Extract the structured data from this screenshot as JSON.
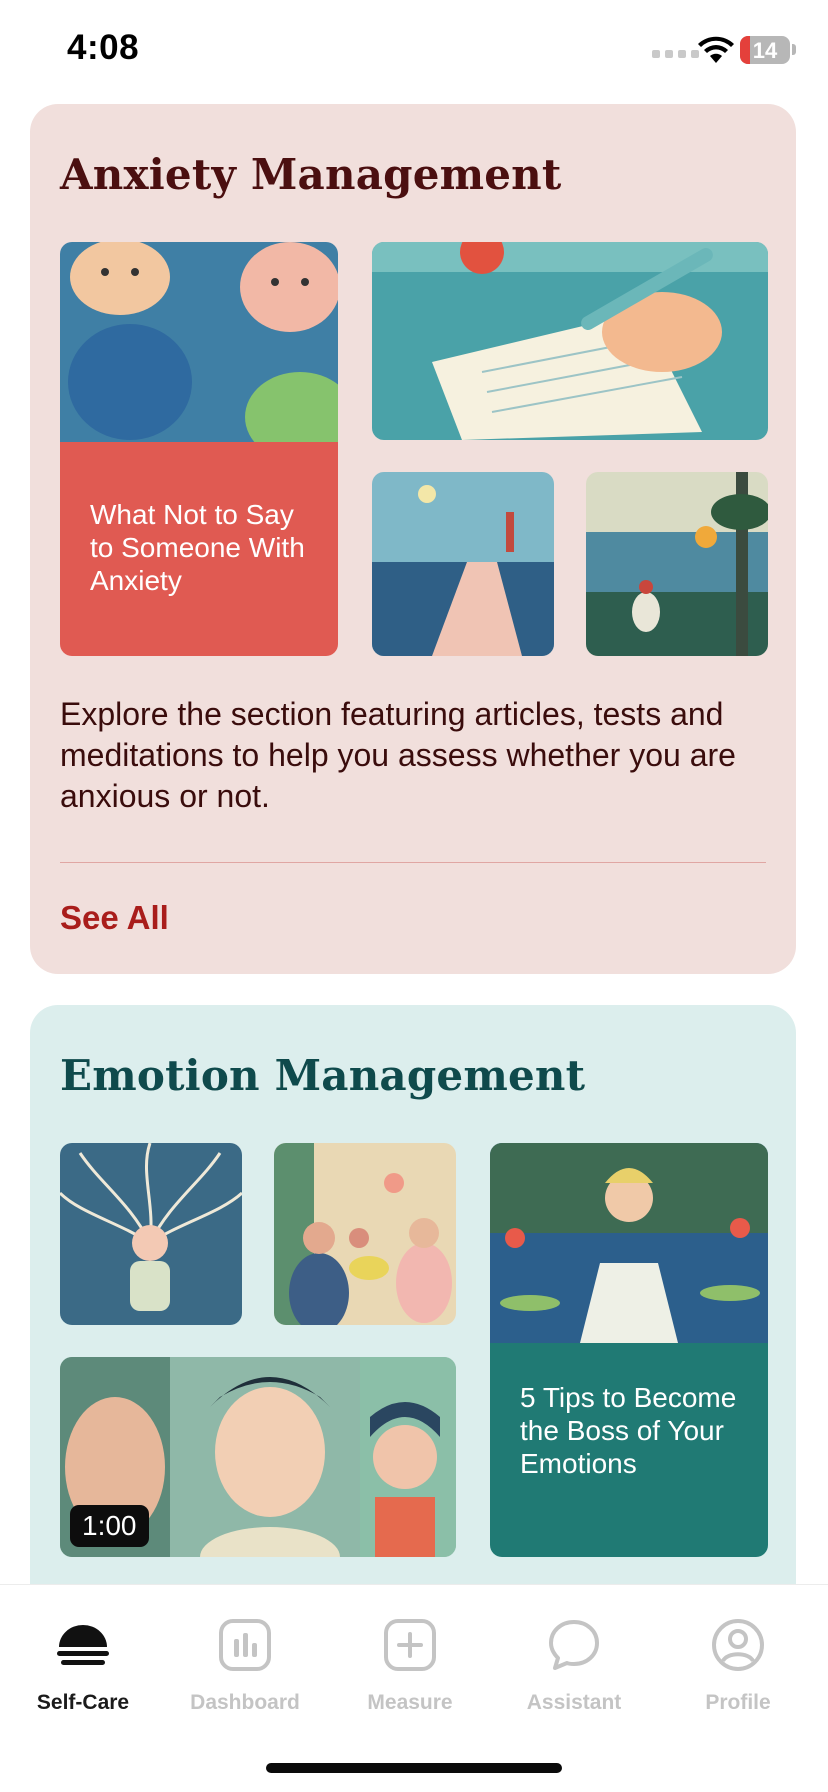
{
  "status_bar": {
    "time": "4:08",
    "battery": "14"
  },
  "anxiety": {
    "title": "Anxiety Management",
    "feature_label": "What Not to Say to Someone With Anxiety",
    "description": "Explore the section featuring articles, tests and meditations to help you assess whether you are anxious or not.",
    "see_all": "See All",
    "accent_color": "#e05a52"
  },
  "emotion": {
    "title": "Emotion Management",
    "feature_label": "5 Tips to Become the Boss of Your Emotions",
    "video_duration": "1:00",
    "accent_color": "#207a74"
  },
  "tabs": [
    {
      "label": "Self-Care",
      "icon": "self-care-icon",
      "active": true
    },
    {
      "label": "Dashboard",
      "icon": "dashboard-icon",
      "active": false
    },
    {
      "label": "Measure",
      "icon": "plus-icon",
      "active": false
    },
    {
      "label": "Assistant",
      "icon": "chat-bubble-icon",
      "active": false
    },
    {
      "label": "Profile",
      "icon": "profile-icon",
      "active": false
    }
  ]
}
